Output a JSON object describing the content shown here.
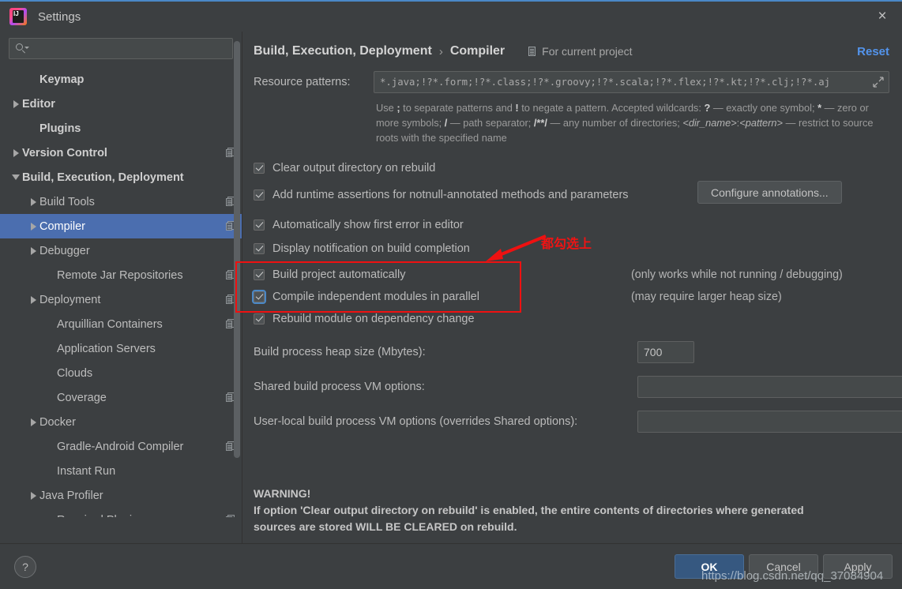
{
  "window": {
    "title": "Settings",
    "logo_icon": "intellij-idea-logo",
    "close_icon": "×"
  },
  "search": {
    "placeholder": "",
    "value": "",
    "icon": "search-icon"
  },
  "sidebar": {
    "items": [
      {
        "label": "Keymap",
        "indent": 1,
        "arrow": "none",
        "bold": true,
        "badge": false,
        "selected": false
      },
      {
        "label": "Editor",
        "indent": 0,
        "arrow": "right",
        "bold": true,
        "badge": false,
        "selected": false
      },
      {
        "label": "Plugins",
        "indent": 1,
        "arrow": "none",
        "bold": true,
        "badge": false,
        "selected": false
      },
      {
        "label": "Version Control",
        "indent": 0,
        "arrow": "right",
        "bold": true,
        "badge": true,
        "selected": false
      },
      {
        "label": "Build, Execution, Deployment",
        "indent": 0,
        "arrow": "down",
        "bold": true,
        "badge": false,
        "selected": false
      },
      {
        "label": "Build Tools",
        "indent": 1,
        "arrow": "right",
        "bold": false,
        "badge": true,
        "selected": false
      },
      {
        "label": "Compiler",
        "indent": 1,
        "arrow": "right",
        "bold": false,
        "badge": true,
        "selected": true
      },
      {
        "label": "Debugger",
        "indent": 1,
        "arrow": "right",
        "bold": false,
        "badge": false,
        "selected": false
      },
      {
        "label": "Remote Jar Repositories",
        "indent": 2,
        "arrow": "none",
        "bold": false,
        "badge": true,
        "selected": false
      },
      {
        "label": "Deployment",
        "indent": 1,
        "arrow": "right",
        "bold": false,
        "badge": true,
        "selected": false
      },
      {
        "label": "Arquillian Containers",
        "indent": 2,
        "arrow": "none",
        "bold": false,
        "badge": true,
        "selected": false
      },
      {
        "label": "Application Servers",
        "indent": 2,
        "arrow": "none",
        "bold": false,
        "badge": false,
        "selected": false
      },
      {
        "label": "Clouds",
        "indent": 2,
        "arrow": "none",
        "bold": false,
        "badge": false,
        "selected": false
      },
      {
        "label": "Coverage",
        "indent": 2,
        "arrow": "none",
        "bold": false,
        "badge": true,
        "selected": false
      },
      {
        "label": "Docker",
        "indent": 1,
        "arrow": "right",
        "bold": false,
        "badge": false,
        "selected": false
      },
      {
        "label": "Gradle-Android Compiler",
        "indent": 2,
        "arrow": "none",
        "bold": false,
        "badge": true,
        "selected": false
      },
      {
        "label": "Instant Run",
        "indent": 2,
        "arrow": "none",
        "bold": false,
        "badge": false,
        "selected": false
      },
      {
        "label": "Java Profiler",
        "indent": 1,
        "arrow": "right",
        "bold": false,
        "badge": false,
        "selected": false
      },
      {
        "label": "Required Plugins",
        "indent": 2,
        "arrow": "none",
        "bold": false,
        "badge": true,
        "selected": false
      }
    ]
  },
  "header": {
    "breadcrumb_parent": "Build, Execution, Deployment",
    "breadcrumb_separator": "›",
    "breadcrumb_current": "Compiler",
    "scope_label": "For current project",
    "scope_icon": "project-scope-icon",
    "reset_label": "Reset"
  },
  "resource_patterns": {
    "label": "Resource patterns:",
    "value": "*.java;!?*.form;!?*.class;!?*.groovy;!?*.scala;!?*.flex;!?*.kt;!?*.clj;!?*.aj",
    "expand_icon": "expand-field-icon",
    "hint_html": "Use <b>;</b> to separate patterns and <b>!</b> to negate a pattern. Accepted wildcards: <b>?</b> &mdash; exactly one symbol; <b>*</b> &mdash; zero or more symbols; <b>/</b> &mdash; path separator; <b>/**/</b> &mdash; any number of directories; <i>&lt;dir_name&gt;</i>:<i>&lt;pattern&gt;</i> &mdash; restrict to source roots with the specified name"
  },
  "options": [
    {
      "label": "Clear output directory on rebuild",
      "checked": true,
      "focused": false,
      "note": "",
      "button": ""
    },
    {
      "label": "Add runtime assertions for notnull-annotated methods and parameters",
      "checked": true,
      "focused": false,
      "note": "",
      "button": "Configure annotations..."
    },
    {
      "label": "Automatically show first error in editor",
      "checked": true,
      "focused": false,
      "note": "",
      "button": ""
    },
    {
      "label": "Display notification on build completion",
      "checked": true,
      "focused": false,
      "note": "",
      "button": ""
    },
    {
      "label": "Build project automatically",
      "checked": true,
      "focused": false,
      "note": "(only works while not running / debugging)",
      "button": ""
    },
    {
      "label": "Compile independent modules in parallel",
      "checked": true,
      "focused": true,
      "note": "(may require larger heap size)",
      "button": ""
    },
    {
      "label": "Rebuild module on dependency change",
      "checked": true,
      "focused": false,
      "note": "",
      "button": ""
    }
  ],
  "annotation": {
    "note_text": "都勾选上",
    "color": "#ee1111",
    "arrow_icon": "red-arrow-icon",
    "box_icon": "red-highlight-box"
  },
  "fields": [
    {
      "label": "Build process heap size (Mbytes):",
      "value": "700",
      "placeholder": "",
      "kind": "heap"
    },
    {
      "label": "Shared build process VM options:",
      "value": "",
      "placeholder": "",
      "kind": "vm"
    },
    {
      "label": "User-local build process VM options (overrides Shared options):",
      "value": "",
      "placeholder": "",
      "kind": "vm"
    }
  ],
  "warning": {
    "title": "WARNING!",
    "line1": "If option 'Clear output directory on rebuild' is enabled, the entire contents of directories where generated",
    "line2": "sources are stored WILL BE CLEARED on rebuild."
  },
  "footer": {
    "help_label": "?",
    "ok_label": "OK",
    "cancel_label": "Cancel",
    "apply_label": "Apply"
  },
  "watermark": {
    "text": "https://blog.csdn.net/qq_37084904"
  }
}
